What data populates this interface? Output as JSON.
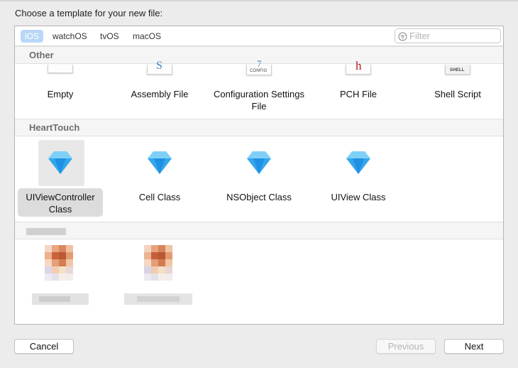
{
  "dialog": {
    "prompt": "Choose a template for your new file:"
  },
  "platform_tabs": [
    {
      "label": "iOS",
      "selected": true
    },
    {
      "label": "watchOS",
      "selected": false
    },
    {
      "label": "tvOS",
      "selected": false
    },
    {
      "label": "macOS",
      "selected": false
    }
  ],
  "filter": {
    "placeholder": "Filter",
    "value": "",
    "icon": "filter-icon"
  },
  "sections": [
    {
      "header": "Other",
      "items": [
        {
          "label": "Empty",
          "icon": "empty-file-icon"
        },
        {
          "label": "Assembly File",
          "icon": "assembly-file-icon",
          "glyph": "S"
        },
        {
          "label": "Configuration Settings File",
          "icon": "config-file-icon",
          "glyph": "7",
          "caption": "CONFIG"
        },
        {
          "label": "PCH File",
          "icon": "pch-file-icon",
          "glyph": "h"
        },
        {
          "label": "Shell Script",
          "icon": "shell-script-icon",
          "caption": "SHELL"
        }
      ]
    },
    {
      "header": "HeartTouch",
      "items": [
        {
          "label": "UIViewController Class",
          "icon": "hearttouch-diamond-icon",
          "selected": true
        },
        {
          "label": "Cell Class",
          "icon": "hearttouch-diamond-icon"
        },
        {
          "label": "NSObject Class",
          "icon": "hearttouch-diamond-icon"
        },
        {
          "label": "UIView Class",
          "icon": "hearttouch-diamond-icon"
        }
      ]
    },
    {
      "header": "",
      "items": [
        {
          "label": "",
          "icon": "pixelated-template-icon"
        },
        {
          "label": "",
          "icon": "pixelated-template-icon"
        }
      ]
    }
  ],
  "buttons": {
    "cancel": "Cancel",
    "previous": "Previous",
    "next": "Next"
  },
  "colors": {
    "accent_selected_tab": "#b9d7f7",
    "diamond_light": "#7fd0f7",
    "diamond_dark": "#1f90e3",
    "window_background": "#ececec"
  }
}
